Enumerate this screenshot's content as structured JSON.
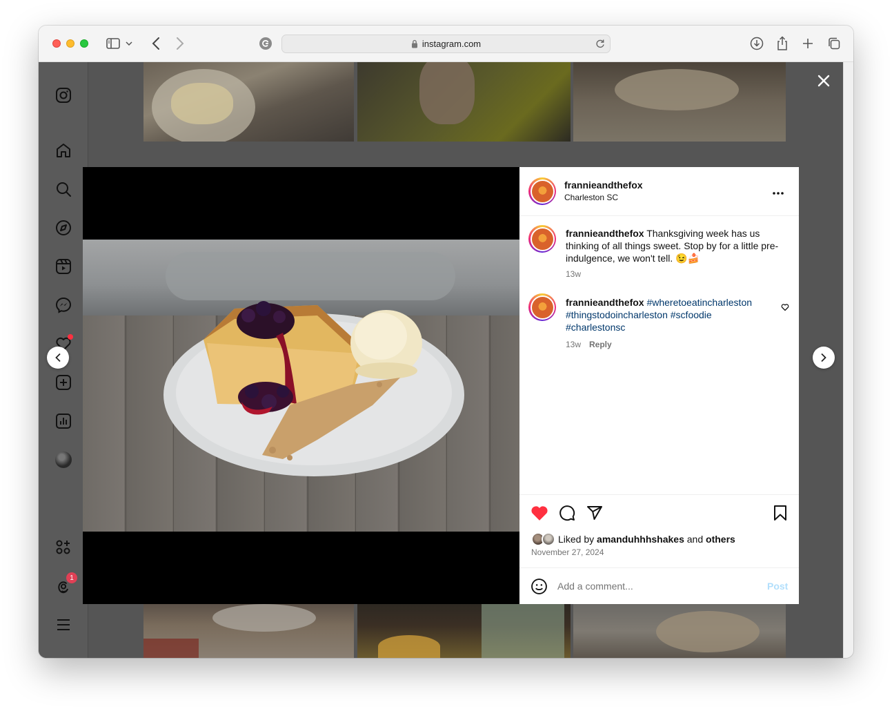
{
  "browser": {
    "url": "instagram.com",
    "icons": [
      "sidebar-icon",
      "back-icon",
      "forward-icon",
      "reader-icon",
      "lock-icon",
      "reload-icon",
      "download-icon",
      "share-icon",
      "new-tab-icon",
      "tabs-icon"
    ]
  },
  "sidebar": {
    "items": [
      "instagram-logo",
      "home",
      "search",
      "explore",
      "reels",
      "messages",
      "notifications",
      "create",
      "dashboard",
      "profile",
      "threads",
      "more"
    ],
    "threads_badge": "1"
  },
  "post": {
    "username": "frannieandthefox",
    "location": "Charleston SC",
    "caption_user": "frannieandthefox",
    "caption_text": " Thanksgiving week has us thinking of all things sweet. Stop by for a little pre-indulgence, we won't tell. 😉🍰",
    "caption_time": "13w",
    "comment_user": "frannieandthefox",
    "comment_tags": " #wheretoeatincharleston #thingstodoincharleston #scfoodie #charlestonsc",
    "comment_time": "13w",
    "reply_label": "Reply",
    "liked_by_prefix": "Liked by ",
    "liked_by_user": "amanduhhhshakes",
    "liked_by_and": " and ",
    "liked_by_others": "others",
    "date": "November 27, 2024",
    "comment_placeholder": "Add a comment...",
    "post_button": "Post"
  },
  "colors": {
    "like_red": "#ff3040",
    "link_blue": "#00376b",
    "post_disabled": "#b2dffc"
  }
}
